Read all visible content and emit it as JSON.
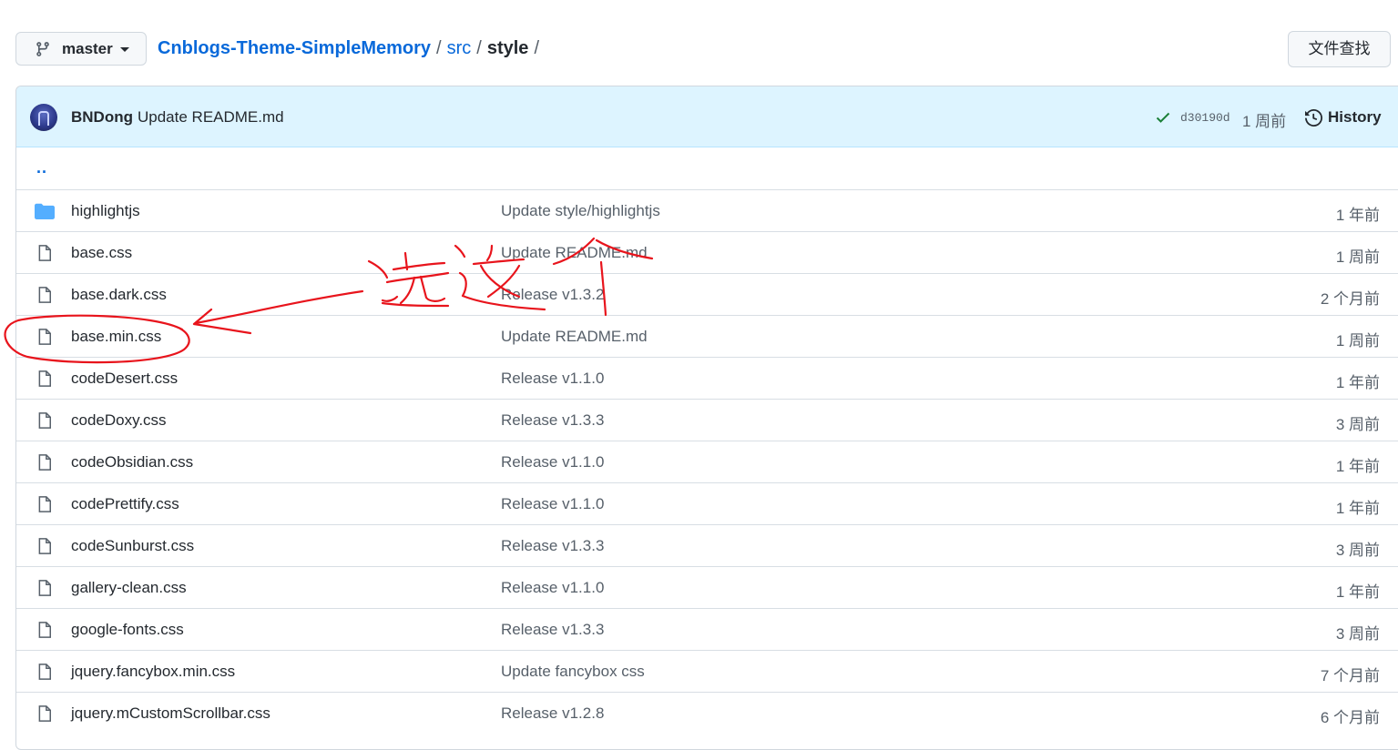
{
  "branch": {
    "name": "master"
  },
  "breadcrumb": {
    "repo": "Cnblogs-Theme-SimpleMemory",
    "sep1": "/",
    "dir": "src",
    "sep2": "/",
    "current": "style",
    "sep3": "/"
  },
  "find_file_label": "文件查找",
  "latest_commit": {
    "author": "BNDong",
    "message": "Update README.md",
    "sha": "d30190d",
    "time": "1 周前",
    "history_label": "History",
    "status": "success"
  },
  "parent_dir": "..",
  "files": [
    {
      "type": "folder",
      "name": "highlightjs",
      "message": "Update style/highlightjs",
      "age": "1 年前"
    },
    {
      "type": "file",
      "name": "base.css",
      "message": "Update README.md",
      "age": "1 周前"
    },
    {
      "type": "file",
      "name": "base.dark.css",
      "message": "Release v1.3.2",
      "age": "2 个月前"
    },
    {
      "type": "file",
      "name": "base.min.css",
      "message": "Update README.md",
      "age": "1 周前"
    },
    {
      "type": "file",
      "name": "codeDesert.css",
      "message": "Release v1.1.0",
      "age": "1 年前"
    },
    {
      "type": "file",
      "name": "codeDoxy.css",
      "message": "Release v1.3.3",
      "age": "3 周前"
    },
    {
      "type": "file",
      "name": "codeObsidian.css",
      "message": "Release v1.1.0",
      "age": "1 年前"
    },
    {
      "type": "file",
      "name": "codePrettify.css",
      "message": "Release v1.1.0",
      "age": "1 年前"
    },
    {
      "type": "file",
      "name": "codeSunburst.css",
      "message": "Release v1.3.3",
      "age": "3 周前"
    },
    {
      "type": "file",
      "name": "gallery-clean.css",
      "message": "Release v1.1.0",
      "age": "1 年前"
    },
    {
      "type": "file",
      "name": "google-fonts.css",
      "message": "Release v1.3.3",
      "age": "3 周前"
    },
    {
      "type": "file",
      "name": "jquery.fancybox.min.css",
      "message": "Update fancybox css",
      "age": "7 个月前"
    },
    {
      "type": "file",
      "name": "jquery.mCustomScrollbar.css",
      "message": "Release v1.2.8",
      "age": "6 个月前"
    }
  ],
  "colors": {
    "link": "#0969da",
    "commit_bar": "#ddf4ff",
    "folder_icon": "#54aeff",
    "annotation": "#e8141c",
    "success": "#1a7f37"
  },
  "annotation": {
    "handwritten_text": "选这个"
  }
}
